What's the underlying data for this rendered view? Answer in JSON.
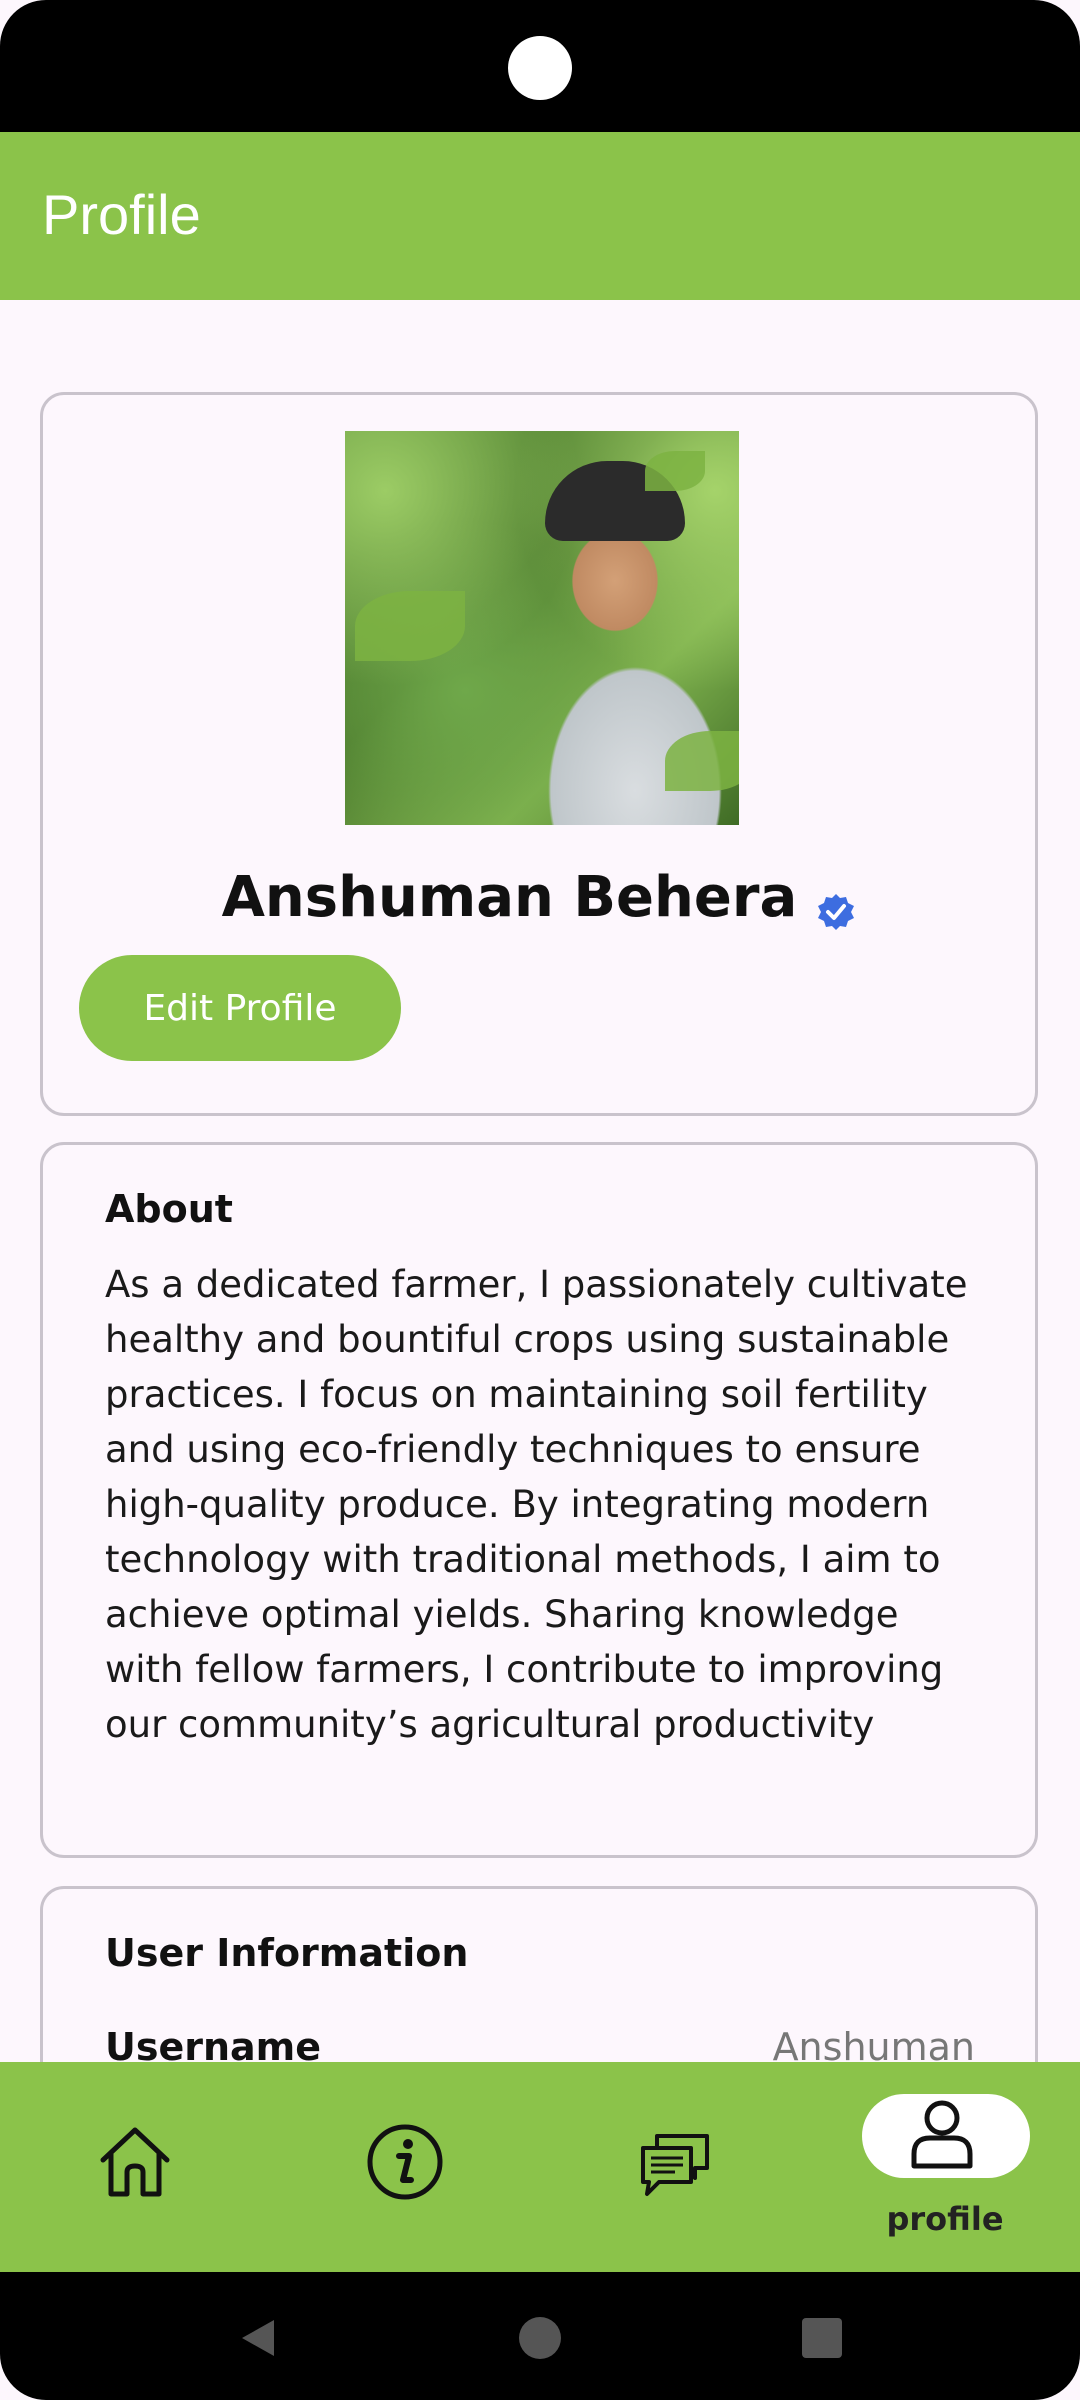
{
  "app_bar": {
    "title": "Profile"
  },
  "profile": {
    "name": "Anshuman Behera",
    "edit_button_label": "Edit Profile",
    "verified_icon": "verified-badge-icon",
    "verified_color": "#3d6de0"
  },
  "about": {
    "title": "About",
    "text": "As a dedicated farmer, I passionately cultivate healthy and bountiful crops using sustainable practices. I focus on maintaining soil fertility and using eco-friendly techniques to ensure high-quality produce. By integrating modern technology with traditional methods, I aim to achieve optimal yields. Sharing knowledge with fellow farmers, I contribute to improving our community’s agricultural productivity"
  },
  "user_info": {
    "title": "User Information",
    "rows": [
      {
        "label": "Username",
        "value": "Anshuman"
      }
    ]
  },
  "bottom_nav": {
    "items": [
      {
        "icon": "home-icon",
        "label": ""
      },
      {
        "icon": "info-icon",
        "label": ""
      },
      {
        "icon": "chat-icon",
        "label": ""
      },
      {
        "icon": "profile-icon",
        "label": "profile",
        "active": true
      }
    ]
  },
  "colors": {
    "accent": "#8bc34a",
    "background": "#fdf7fd"
  }
}
